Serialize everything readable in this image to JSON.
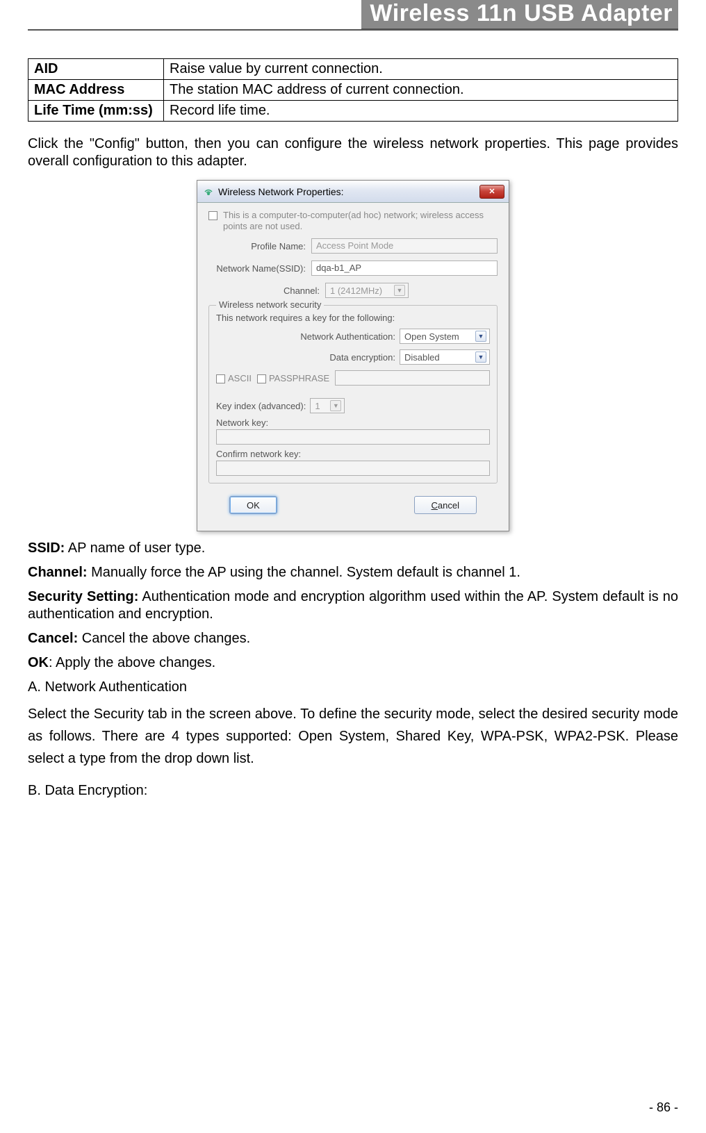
{
  "header": {
    "title": "Wireless 11n USB Adapter"
  },
  "table": {
    "rows": [
      {
        "label": "AID",
        "desc": "Raise value by current connection."
      },
      {
        "label": "MAC Address",
        "desc": "The station MAC address of current connection."
      },
      {
        "label": "Life Time (mm:ss)",
        "desc": "Record life time."
      }
    ]
  },
  "intro_text": "Click the \"Config\" button, then you can configure the wireless network properties. This page provides overall configuration to this adapter.",
  "dialog": {
    "title": "Wireless Network Properties:",
    "adhoc_text": "This is a computer-to-computer(ad hoc) network; wireless access points are not used.",
    "profile_label": "Profile Name:",
    "profile_value": "Access Point Mode",
    "ssid_label": "Network Name(SSID):",
    "ssid_value": "dqa-b1_AP",
    "channel_label": "Channel:",
    "channel_value": "1 (2412MHz)",
    "security_legend": "Wireless network security",
    "security_line": "This network requires a key for the following:",
    "netauth_label": "Network Authentication:",
    "netauth_value": "Open System",
    "dataenc_label": "Data encryption:",
    "dataenc_value": "Disabled",
    "ascii_label": "ASCII",
    "passphrase_label": "PASSPHRASE",
    "keyidx_label": "Key index (advanced):",
    "keyidx_value": "1",
    "netkey_label": "Network key:",
    "confirm_label": "Confirm network key:",
    "ok_label": "OK",
    "cancel_label": "Cancel"
  },
  "definitions": [
    {
      "term": "SSID:",
      "desc": " AP name of user type."
    },
    {
      "term": "Channel:",
      "desc": " Manually force the AP using the channel. System default is channel 1."
    },
    {
      "term": "Security Setting:",
      "desc": " Authentication mode and encryption algorithm used within the AP. System default is no authentication and encryption."
    },
    {
      "term": "Cancel:",
      "desc": " Cancel the above changes."
    },
    {
      "term": "OK",
      "desc": ": Apply the above changes."
    }
  ],
  "section_a": {
    "heading": "A. Network Authentication",
    "body": "Select the Security tab in the screen above. To define the security mode, select the desired security mode as follows. There are 4 types supported: Open System, Shared Key, WPA-PSK, WPA2-PSK. Please select a type from the drop down list."
  },
  "section_b": {
    "heading": "B. Data Encryption:"
  },
  "footer": {
    "page": "- 86 -"
  }
}
